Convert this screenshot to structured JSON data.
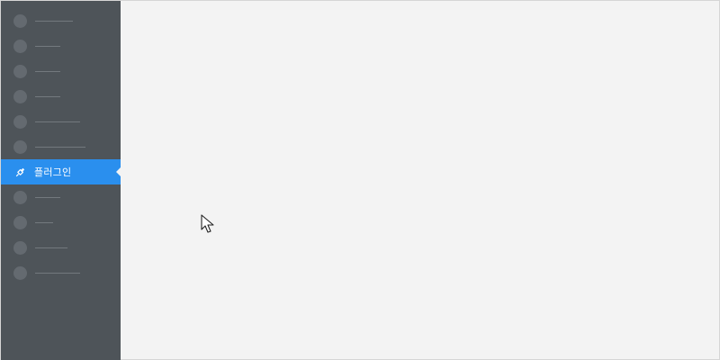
{
  "sidebar": {
    "active_item": {
      "label": "플러그인",
      "icon": "plugin-icon"
    },
    "colors": {
      "background": "#4e5459",
      "active": "#2a8fee"
    }
  },
  "cursor": {
    "icon": "mouse-pointer-icon"
  }
}
